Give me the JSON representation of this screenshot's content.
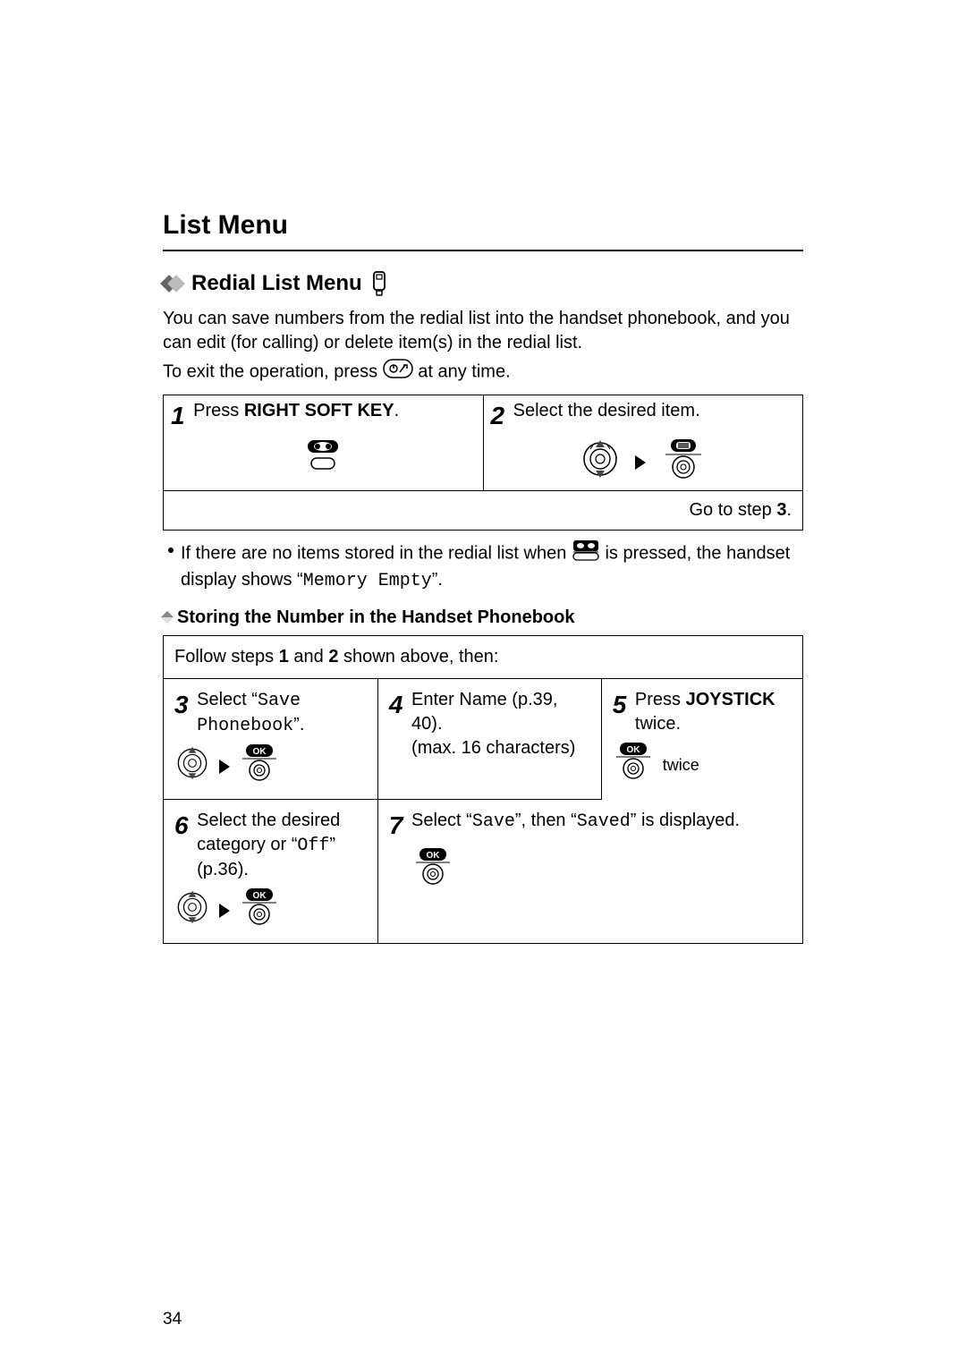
{
  "title": "List Menu",
  "subsection": "Redial List Menu",
  "intro": {
    "line1": "You can save numbers from the redial list into the handset phonebook, and you can edit (for calling) or delete item(s) in the redial list.",
    "line2_a": "To exit the operation, press ",
    "line2_b": " at any time."
  },
  "step1": {
    "num": "1",
    "prefix": "Press ",
    "key": "RIGHT SOFT KEY",
    "suffix": "."
  },
  "step2": {
    "num": "2",
    "text": "Select the desired item."
  },
  "goto": {
    "prefix": "Go to step ",
    "num": "3",
    "suffix": "."
  },
  "bullet": {
    "a": "If there are no items stored in the redial list when ",
    "b": " is pressed, the handset display shows “",
    "mono": "Memory Empty",
    "c": "”."
  },
  "storing_title": "Storing the Number in the Handset Phonebook",
  "follow": {
    "a": "Follow steps ",
    "n1": "1",
    "mid": " and ",
    "n2": "2",
    "b": " shown above, then:"
  },
  "s3": {
    "num": "3",
    "prefix": "Select “",
    "mono": "Save Phonebook",
    "suffix": "”."
  },
  "s4": {
    "num": "4",
    "line1": "Enter Name (p.39, 40).",
    "line2": "(max. 16 characters)"
  },
  "s5": {
    "num": "5",
    "prefix": "Press ",
    "key": "JOYSTICK",
    "suffix": " twice.",
    "twice": "twice"
  },
  "s6": {
    "num": "6",
    "a": "Select the desired category or “",
    "mono": "Off",
    "b": "” (p.36)."
  },
  "s7": {
    "num": "7",
    "a": "Select “",
    "mono1": "Save",
    "b": "”, then “",
    "mono2": "Saved",
    "c": "” is displayed."
  },
  "page_number": "34"
}
